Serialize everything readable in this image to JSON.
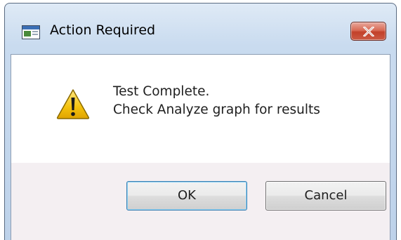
{
  "dialog": {
    "title": "Action Required",
    "message_line1": "Test Complete.",
    "message_line2": "Check Analyze graph for results",
    "ok_label": "OK",
    "cancel_label": "Cancel",
    "icons": {
      "app": "app-window-icon",
      "close": "close-icon",
      "warning": "warning-icon"
    },
    "colors": {
      "close_button": "#c2412a",
      "warning_yellow": "#f4c20d",
      "button_bar": "#f4eff2"
    }
  }
}
